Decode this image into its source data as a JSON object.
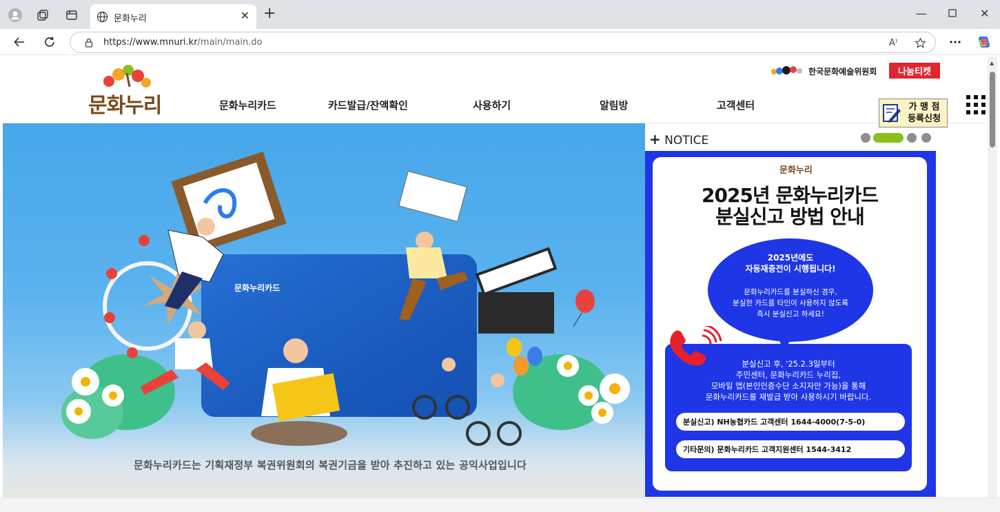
{
  "browser": {
    "tab_title": "문화누리",
    "url_host": "https://www.mnuri.kr",
    "url_path": "/main/main.do",
    "new_tab": "+",
    "read_aloud": "A⁾"
  },
  "site": {
    "logo_text": "문화누리",
    "nav": [
      "문화누리카드",
      "카드발급/잔액확인",
      "사용하기",
      "알림방",
      "고객센터"
    ],
    "arko_text": "한국문화예술위원회",
    "nanum_ticket": "나눔티켓",
    "merchant_line1": "가 맹 점",
    "merchant_line2": "등록신청"
  },
  "hero": {
    "card_label": "문화누리카드",
    "caption": "문화누리카드는 기획재정부 복권위원회의 복권기금을 받아 추진하고 있는 공익사업입니다"
  },
  "notice": {
    "label": "NOTICE",
    "plus": "+",
    "logo_text": "문화누리",
    "title_line1": "2025년 문화누리카드",
    "title_line2": "분실신고 방법 안내",
    "bubble_head1": "2025년에도",
    "bubble_head2": "자동재충전이 시행됩니다!",
    "bubble_body1": "문화누리카드를 분실하신 경우,",
    "bubble_body2": "분실한 카드를 타인이 사용하지 않도록",
    "bubble_body3": "즉시 분실신고 하세요!",
    "box_line1": "분실신고 후, '25.2.3일부터",
    "box_line2": "주민센터, 문화누리카드 누리집,",
    "box_line3": "모바일 앱(본인인증수단 소지자만 가능)을 통해",
    "box_line4": "문화누리카드를 재발급 받아 사용하시기 바랍니다.",
    "pill1": "분실신고) NH농협카드 고객센터  1644-4000(7-5-0)",
    "pill2": "기타문의) 문화누리카드 고객지원센터  1544-3412",
    "active_slide": 2,
    "slide_count": 4
  },
  "colors": {
    "accent_blue": "#1e36e6",
    "indicator_active": "#8cbf1f",
    "nanum_red": "#e0262e",
    "logo_brown": "#7a4a1c"
  }
}
